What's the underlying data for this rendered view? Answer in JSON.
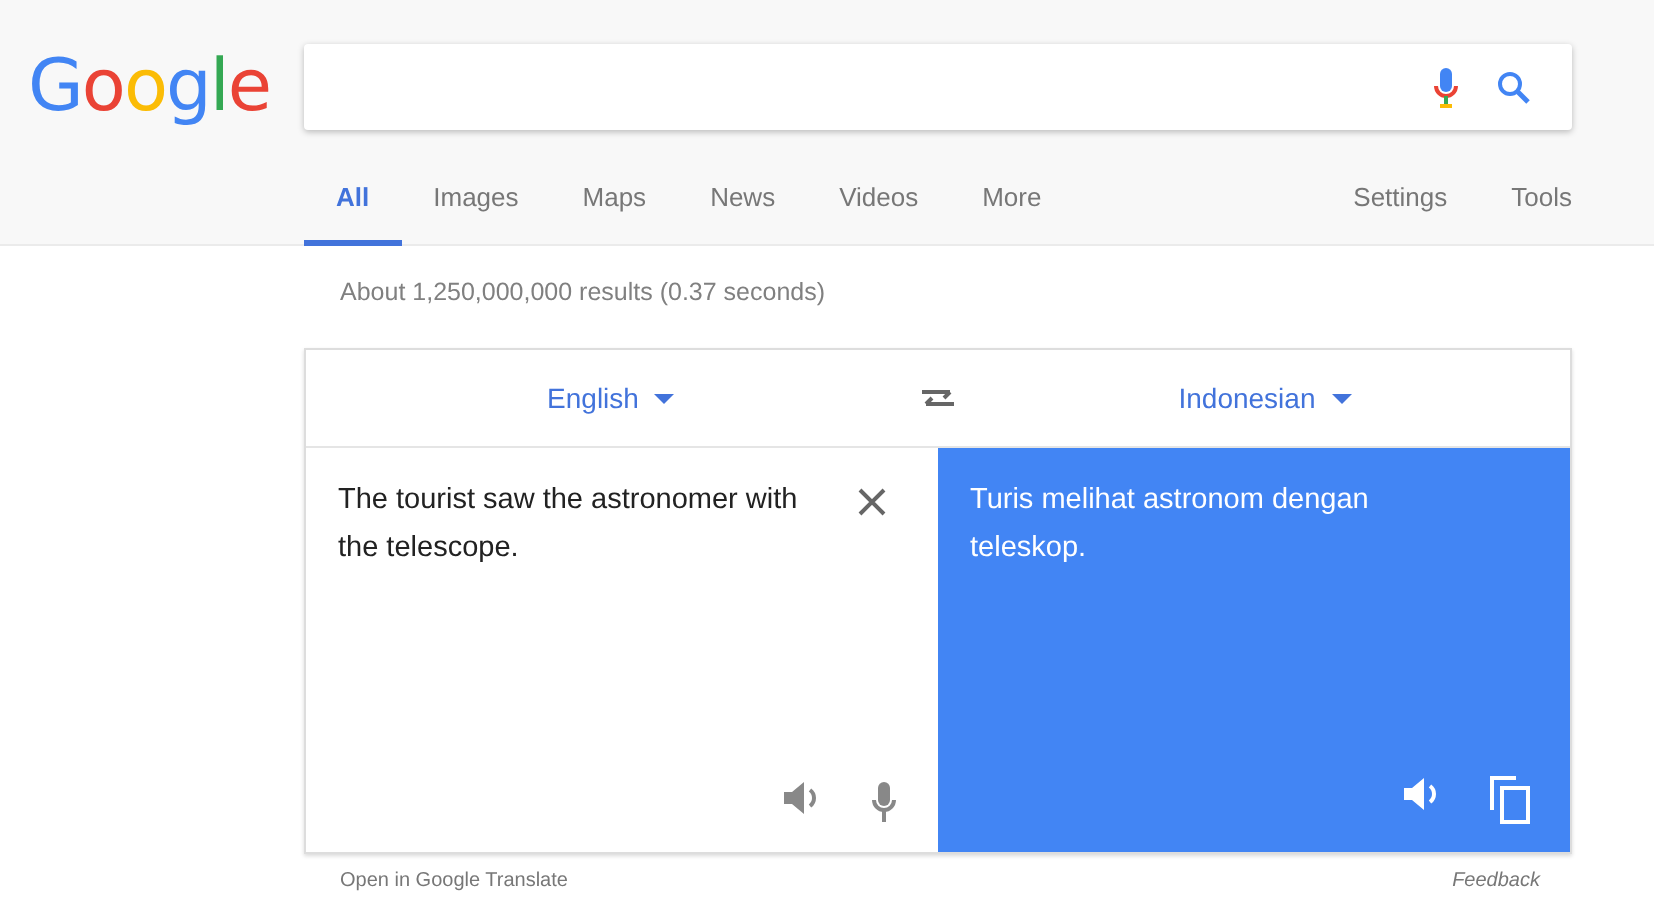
{
  "logo": "Google",
  "tabs": [
    {
      "label": "All",
      "selected": true
    },
    {
      "label": "Images",
      "selected": false
    },
    {
      "label": "Maps",
      "selected": false
    },
    {
      "label": "News",
      "selected": false
    },
    {
      "label": "Videos",
      "selected": false
    },
    {
      "label": "More",
      "selected": false
    }
  ],
  "tools": [
    "Settings",
    "Tools"
  ],
  "result_stats": "About 1,250,000,000 results (0.37 seconds)",
  "translate": {
    "source_language": "English",
    "target_language": "Indonesian",
    "source_text": "The tourist saw the astronomer with the telescope.",
    "translated_text": "Turis melihat astronom dengan teleskop.",
    "open_link": "Open in Google Translate",
    "feedback": "Feedback"
  }
}
